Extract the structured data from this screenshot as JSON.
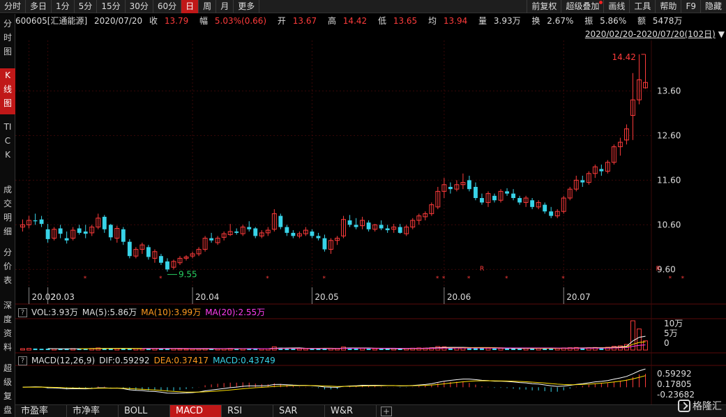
{
  "toolbar": {
    "periods": [
      "分时",
      "多日",
      "1分",
      "5分",
      "15分",
      "30分",
      "60分",
      "日",
      "周",
      "月",
      "更多"
    ],
    "active_period": "日",
    "right": [
      "前复权",
      "超级叠加",
      "画线",
      "工具",
      "帮助",
      "F9",
      "隐藏"
    ]
  },
  "sidebar": [
    {
      "label": "分时图",
      "active": false
    },
    {
      "label": "K线图",
      "active": true
    },
    {
      "label": "TICK",
      "active": false
    },
    {
      "label": "成交明细",
      "active": false
    },
    {
      "label": "分价表",
      "active": false
    },
    {
      "label": "深度资料",
      "active": false
    },
    {
      "label": "超级复盘",
      "active": false
    }
  ],
  "quote": {
    "code_name": "600605[汇通能源]",
    "date": "2020/07/20",
    "close_label": "收",
    "close": "13.79",
    "change_label": "幅",
    "change": "5.03%(0.66)",
    "open_label": "开",
    "open": "13.67",
    "high_label": "高",
    "high": "14.42",
    "low_label": "低",
    "low": "13.65",
    "avg_label": "均",
    "avg": "13.94",
    "vol_label": "量",
    "vol": "3.93万",
    "turnover_label": "换",
    "turnover": "2.67%",
    "amplitude_label": "振",
    "amplitude": "5.86%",
    "amount_label": "额",
    "amount": "5478万"
  },
  "range_label": "2020/02/20-2020/07/20(102日)",
  "vol_panel": {
    "vol": "VOL:3.93万",
    "ma5": "MA(5):5.86万",
    "ma10": "MA(10):3.99万",
    "ma20": "MA(20):2.55万"
  },
  "macd_panel": {
    "title": "MACD(12,26,9)",
    "dif": "DIF:0.59292",
    "dea": "DEA:0.37417",
    "macd": "MACD:0.43749"
  },
  "bottom_tabs": [
    {
      "label": "市盈率",
      "active": false
    },
    {
      "label": "市净率",
      "active": false
    },
    {
      "label": "BOLL",
      "active": false
    },
    {
      "label": "MACD",
      "active": true
    },
    {
      "label": "RSI",
      "active": false
    },
    {
      "label": "SAR",
      "active": false
    },
    {
      "label": "W&R",
      "active": false
    }
  ],
  "logo": "格隆汇",
  "colors": {
    "up": "#ff3b3b",
    "down": "#38d3e8",
    "dif": "#ffffff",
    "dea": "#ffe000",
    "ma5": "#ffffff",
    "ma10": "#ffe000",
    "ma20": "#ff3cf0"
  },
  "chart_data": {
    "type": "candlestick",
    "x_ticks": [
      "20.02",
      "20.03",
      "20.04",
      "20.05",
      "20.06",
      "20.07"
    ],
    "price_axis_ticks": [
      "13.60",
      "12.60",
      "11.60",
      "10.60",
      "9.60"
    ],
    "ylim": [
      9.2,
      14.7
    ],
    "max_label": "14.42",
    "min_label": "9.55",
    "marker_labels": [
      "*",
      "R"
    ],
    "vol_axis_ticks": [
      "10万",
      "5万",
      "0"
    ],
    "macd_axis_ticks": [
      "0.59292",
      "0.17805",
      "-0.23682"
    ],
    "macd_ylim": [
      -0.35,
      0.7
    ],
    "ohlc": [
      [
        10.55,
        10.72,
        10.45,
        10.6
      ],
      [
        10.6,
        10.8,
        10.52,
        10.7
      ],
      [
        10.7,
        10.85,
        10.6,
        10.68
      ],
      [
        10.72,
        10.8,
        10.55,
        10.62
      ],
      [
        10.5,
        10.62,
        10.2,
        10.28
      ],
      [
        10.3,
        10.55,
        10.25,
        10.5
      ],
      [
        10.52,
        10.6,
        10.3,
        10.4
      ],
      [
        10.3,
        10.45,
        10.18,
        10.25
      ],
      [
        10.3,
        10.55,
        10.25,
        10.48
      ],
      [
        10.52,
        10.6,
        10.38,
        10.42
      ],
      [
        10.45,
        10.6,
        10.3,
        10.4
      ],
      [
        10.42,
        10.6,
        10.35,
        10.55
      ],
      [
        10.55,
        10.85,
        10.5,
        10.75
      ],
      [
        10.78,
        10.82,
        10.42,
        10.5
      ],
      [
        10.6,
        10.62,
        10.25,
        10.32
      ],
      [
        10.3,
        10.58,
        10.2,
        10.52
      ],
      [
        10.5,
        10.55,
        10.15,
        10.22
      ],
      [
        10.22,
        10.28,
        9.85,
        9.9
      ],
      [
        9.9,
        10.1,
        9.85,
        10.05
      ],
      [
        10.05,
        10.2,
        9.95,
        10.15
      ],
      [
        10.1,
        10.15,
        9.82,
        9.88
      ],
      [
        9.85,
        10.05,
        9.75,
        10.0
      ],
      [
        9.9,
        9.95,
        9.7,
        9.75
      ],
      [
        9.78,
        9.85,
        9.55,
        9.6
      ],
      [
        9.65,
        9.82,
        9.6,
        9.78
      ],
      [
        9.75,
        9.9,
        9.7,
        9.85
      ],
      [
        9.85,
        9.92,
        9.8,
        9.88
      ],
      [
        9.9,
        10.0,
        9.85,
        9.95
      ],
      [
        9.95,
        10.1,
        9.9,
        10.05
      ],
      [
        10.05,
        10.35,
        10.0,
        10.3
      ],
      [
        10.3,
        10.42,
        10.2,
        10.25
      ],
      [
        10.2,
        10.35,
        10.15,
        10.3
      ],
      [
        10.32,
        10.45,
        10.25,
        10.4
      ],
      [
        10.38,
        10.62,
        10.35,
        10.45
      ],
      [
        10.45,
        10.52,
        10.38,
        10.42
      ],
      [
        10.4,
        10.6,
        10.35,
        10.55
      ],
      [
        10.55,
        10.68,
        10.45,
        10.5
      ],
      [
        10.52,
        10.55,
        10.3,
        10.35
      ],
      [
        10.35,
        10.48,
        10.3,
        10.42
      ],
      [
        10.42,
        10.55,
        10.35,
        10.48
      ],
      [
        10.5,
        10.95,
        10.45,
        10.85
      ],
      [
        10.8,
        10.85,
        10.5,
        10.55
      ],
      [
        10.55,
        10.6,
        10.35,
        10.42
      ],
      [
        10.42,
        10.48,
        10.3,
        10.35
      ],
      [
        10.35,
        10.45,
        10.3,
        10.4
      ],
      [
        10.4,
        10.55,
        10.35,
        10.48
      ],
      [
        10.45,
        10.5,
        10.3,
        10.35
      ],
      [
        10.35,
        10.42,
        10.25,
        10.3
      ],
      [
        10.3,
        10.38,
        10.0,
        10.05
      ],
      [
        10.05,
        10.3,
        9.95,
        10.25
      ],
      [
        10.25,
        10.35,
        10.15,
        10.3
      ],
      [
        10.35,
        10.8,
        10.3,
        10.72
      ],
      [
        10.7,
        10.82,
        10.55,
        10.6
      ],
      [
        10.6,
        10.75,
        10.5,
        10.55
      ],
      [
        10.58,
        10.78,
        10.5,
        10.7
      ],
      [
        10.65,
        10.7,
        10.45,
        10.5
      ],
      [
        10.5,
        10.62,
        10.45,
        10.6
      ],
      [
        10.6,
        10.7,
        10.48,
        10.52
      ],
      [
        10.52,
        10.6,
        10.42,
        10.48
      ],
      [
        10.5,
        10.62,
        10.42,
        10.55
      ],
      [
        10.55,
        10.62,
        10.4,
        10.42
      ],
      [
        10.4,
        10.6,
        10.35,
        10.55
      ],
      [
        10.55,
        10.75,
        10.5,
        10.7
      ],
      [
        10.7,
        10.85,
        10.6,
        10.8
      ],
      [
        10.78,
        10.9,
        10.7,
        10.85
      ],
      [
        10.85,
        11.1,
        10.8,
        11.05
      ],
      [
        11.0,
        11.45,
        10.95,
        11.35
      ],
      [
        11.35,
        11.65,
        11.2,
        11.5
      ],
      [
        11.45,
        11.55,
        11.3,
        11.4
      ],
      [
        11.4,
        11.6,
        11.35,
        11.5
      ],
      [
        11.5,
        11.75,
        11.4,
        11.55
      ],
      [
        11.6,
        11.7,
        11.35,
        11.4
      ],
      [
        11.45,
        11.55,
        11.15,
        11.2
      ],
      [
        11.2,
        11.3,
        11.05,
        11.1
      ],
      [
        11.1,
        11.35,
        11.0,
        11.3
      ],
      [
        11.25,
        11.3,
        11.1,
        11.15
      ],
      [
        11.15,
        11.4,
        11.1,
        11.35
      ],
      [
        11.35,
        11.42,
        11.25,
        11.3
      ],
      [
        11.3,
        11.4,
        11.15,
        11.2
      ],
      [
        11.2,
        11.25,
        11.05,
        11.1
      ],
      [
        11.1,
        11.25,
        11.0,
        11.2
      ],
      [
        11.15,
        11.2,
        10.95,
        11.0
      ],
      [
        11.0,
        11.15,
        10.95,
        11.1
      ],
      [
        11.05,
        11.1,
        10.85,
        10.9
      ],
      [
        10.9,
        11.0,
        10.75,
        10.8
      ],
      [
        10.8,
        10.95,
        10.75,
        10.9
      ],
      [
        10.9,
        11.25,
        10.85,
        11.2
      ],
      [
        11.2,
        11.45,
        11.15,
        11.4
      ],
      [
        11.4,
        11.7,
        11.35,
        11.6
      ],
      [
        11.6,
        11.7,
        11.45,
        11.55
      ],
      [
        11.55,
        11.8,
        11.5,
        11.75
      ],
      [
        11.75,
        11.95,
        11.65,
        11.9
      ],
      [
        11.85,
        11.95,
        11.7,
        11.8
      ],
      [
        11.8,
        12.05,
        11.75,
        12.0
      ],
      [
        12.0,
        12.4,
        11.95,
        12.35
      ],
      [
        12.35,
        12.55,
        12.15,
        12.45
      ],
      [
        12.5,
        12.85,
        12.4,
        12.75
      ],
      [
        13.05,
        14.0,
        12.5,
        13.4
      ],
      [
        13.4,
        14.42,
        13.3,
        13.85
      ],
      [
        13.67,
        14.42,
        13.65,
        13.79
      ]
    ],
    "volume": [
      0.6,
      0.7,
      0.65,
      0.55,
      0.6,
      0.55,
      0.5,
      0.6,
      0.65,
      0.6,
      0.55,
      0.7,
      0.9,
      0.8,
      0.65,
      0.6,
      0.7,
      0.8,
      0.6,
      0.55,
      0.6,
      0.65,
      0.7,
      0.8,
      0.6,
      0.5,
      0.45,
      0.5,
      0.55,
      0.65,
      0.6,
      0.55,
      0.6,
      0.7,
      0.55,
      0.6,
      0.65,
      0.6,
      0.55,
      0.6,
      1.4,
      1.0,
      0.8,
      0.7,
      0.65,
      0.6,
      0.55,
      0.6,
      0.8,
      0.7,
      0.6,
      1.3,
      1.0,
      0.8,
      0.7,
      0.65,
      0.6,
      0.55,
      0.6,
      0.65,
      0.6,
      0.7,
      0.8,
      0.9,
      0.85,
      1.0,
      1.5,
      1.4,
      1.0,
      0.9,
      1.0,
      1.1,
      1.0,
      0.9,
      0.8,
      0.7,
      0.75,
      0.7,
      0.65,
      0.7,
      0.7,
      0.75,
      0.7,
      0.75,
      0.8,
      0.7,
      0.9,
      1.0,
      1.1,
      0.9,
      1.0,
      1.1,
      1.0,
      1.2,
      1.6,
      1.8,
      2.4,
      12.5,
      9.0,
      3.93
    ],
    "marks": [
      {
        "i": 10,
        "label": "*"
      },
      {
        "i": 22,
        "label": "*"
      },
      {
        "i": 39,
        "label": "*"
      },
      {
        "i": 48,
        "label": "*"
      },
      {
        "i": 66,
        "label": "*"
      },
      {
        "i": 67,
        "label": "*"
      },
      {
        "i": 71,
        "label": "*"
      },
      {
        "i": 73,
        "label": "R"
      },
      {
        "i": 77,
        "label": "*"
      },
      {
        "i": 86,
        "label": "*"
      },
      {
        "i": 101,
        "label": "R"
      },
      {
        "i": 103,
        "label": "*"
      },
      {
        "i": 105,
        "label": "*"
      }
    ]
  }
}
